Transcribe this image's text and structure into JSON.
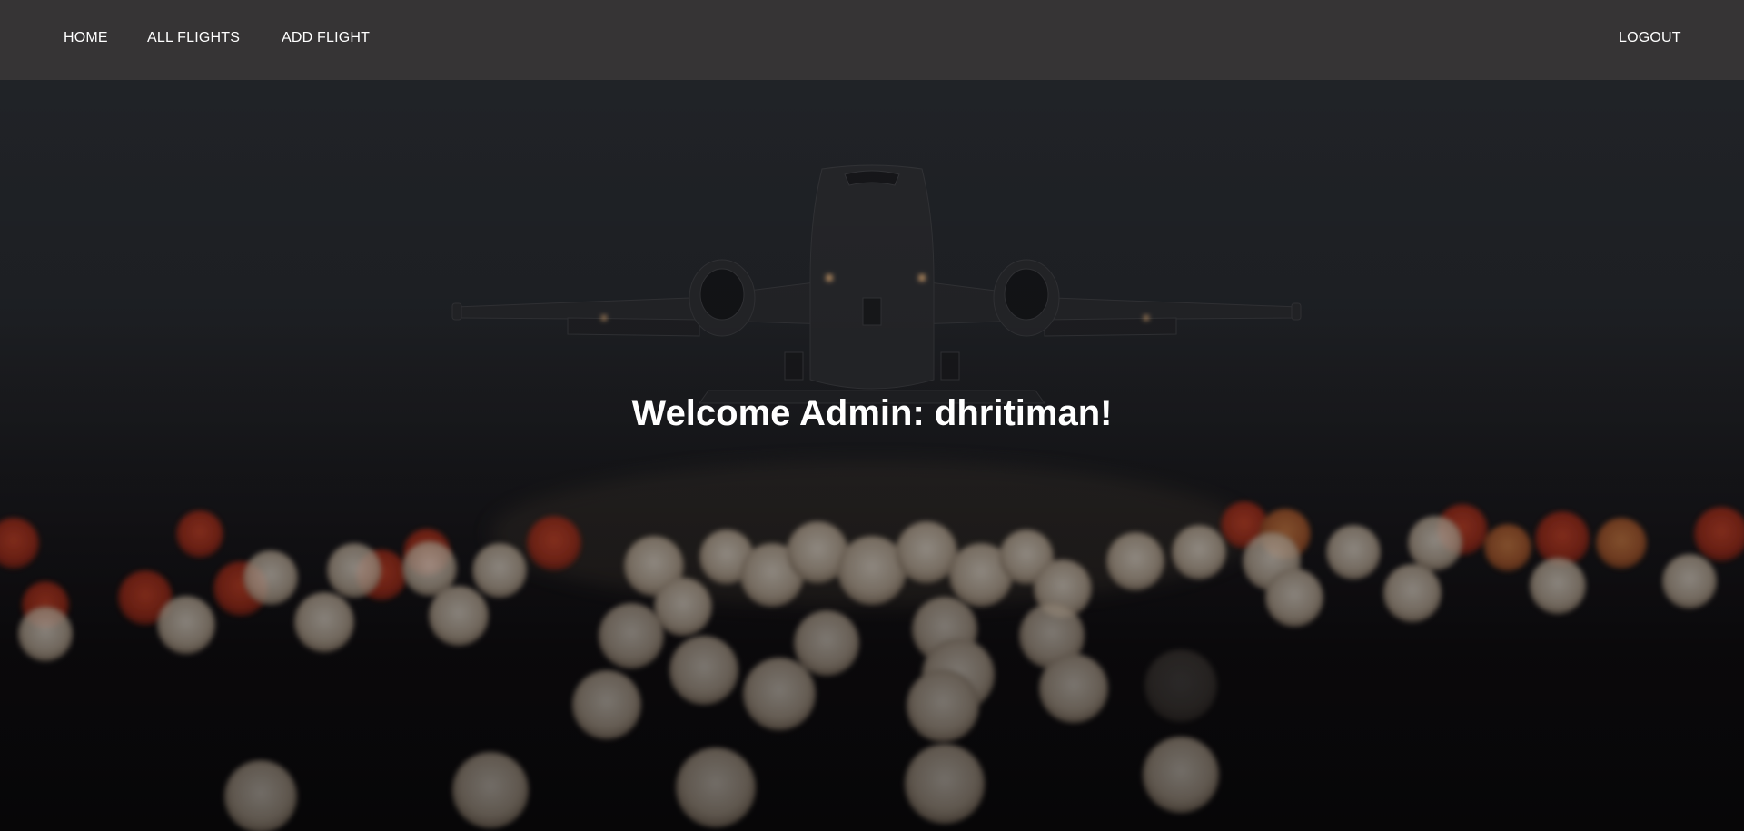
{
  "nav": {
    "home_label": "HOME",
    "all_flights_label": "ALL FLIGHTS",
    "add_flight_label": "ADD FLIGHT",
    "logout_label": "LOGOUT"
  },
  "hero": {
    "welcome_text": "Welcome Admin: dhritiman!",
    "background_image": "airplane-takeoff-night-bokeh-runway-lights"
  },
  "colors": {
    "navbar_bg": "#363435",
    "nav_text": "#ffffff",
    "hero_overlay": "#1a1a1e"
  }
}
